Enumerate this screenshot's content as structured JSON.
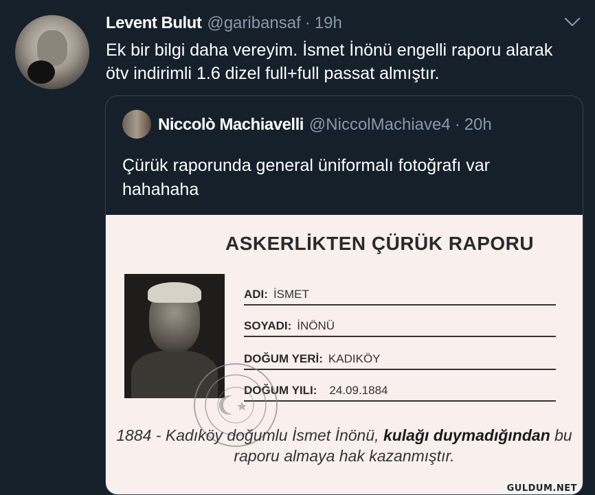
{
  "tweet": {
    "author_name": "Levent Bulut",
    "author_handle": "@garibansaf",
    "separator": "·",
    "time": "19h",
    "text": "Ek bir bilgi daha vereyim. İsmet İnönü engelli raporu alarak ötv indirimli 1.6 dizel full+full passat almıştır."
  },
  "quoted": {
    "author_name": "Niccolò Machiavelli",
    "author_handle": "@NiccolMachiave4",
    "separator": "·",
    "time": "20h",
    "text": "Çürük raporunda general üniformalı fotoğrafı var hahahaha"
  },
  "document": {
    "title": "ASKERLİKTEN ÇÜRÜK RAPORU",
    "fields": [
      {
        "label": "ADI:",
        "value": "İSMET"
      },
      {
        "label": "SOYADI:",
        "value": "İNÖNÜ"
      },
      {
        "label": "DOĞUM YERİ:",
        "value": "KADIKÖY"
      },
      {
        "label": "DOĞUM YILI:",
        "value": "24.09.1884"
      }
    ],
    "caption_part1": "1884 - Kadıköy doğumlu İsmet İnönü, ",
    "caption_bold": "kulağı duymadığından",
    "caption_part2": " bu raporu almaya hak kazanmıştır."
  },
  "watermark": "GULDUM.NET",
  "icons": {
    "menu": "chevron-down-icon"
  }
}
